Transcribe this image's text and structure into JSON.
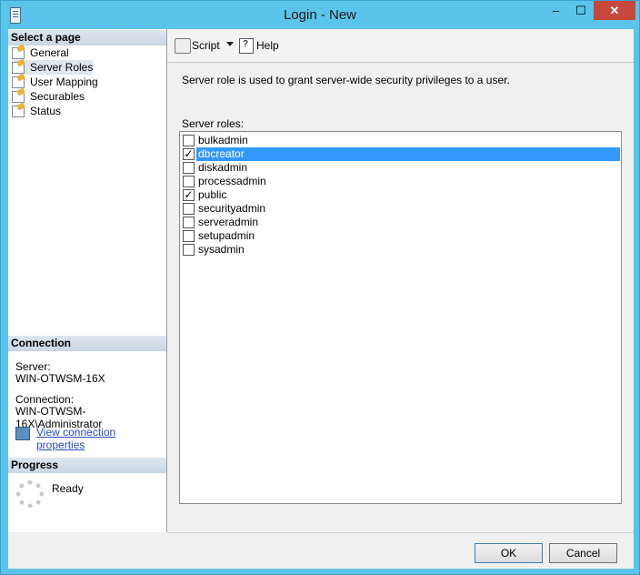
{
  "window": {
    "title": "Login - New",
    "min": "–",
    "max": "☐",
    "close": "✕"
  },
  "left": {
    "select_page_header": "Select a page",
    "pages": [
      "General",
      "Server Roles",
      "User Mapping",
      "Securables",
      "Status"
    ],
    "selected_page": "Server Roles",
    "connection_header": "Connection",
    "server_label": "Server:",
    "server_value": "WIN-OTWSM-16X",
    "connection_label": "Connection:",
    "connection_value": "WIN-OTWSM-16X\\Administrator",
    "view_props_link": "View connection properties",
    "progress_header": "Progress",
    "progress_status": "Ready"
  },
  "toolbar": {
    "script_label": "Script",
    "help_label": "Help"
  },
  "main": {
    "description": "Server role is used to grant server-wide security privileges to a user.",
    "roles_label": "Server roles:",
    "roles": [
      {
        "name": "bulkadmin",
        "checked": false,
        "selected": false
      },
      {
        "name": "dbcreator",
        "checked": true,
        "selected": true
      },
      {
        "name": "diskadmin",
        "checked": false,
        "selected": false
      },
      {
        "name": "processadmin",
        "checked": false,
        "selected": false
      },
      {
        "name": "public",
        "checked": true,
        "selected": false
      },
      {
        "name": "securityadmin",
        "checked": false,
        "selected": false
      },
      {
        "name": "serveradmin",
        "checked": false,
        "selected": false
      },
      {
        "name": "setupadmin",
        "checked": false,
        "selected": false
      },
      {
        "name": "sysadmin",
        "checked": false,
        "selected": false
      }
    ]
  },
  "buttons": {
    "ok": "OK",
    "cancel": "Cancel"
  }
}
